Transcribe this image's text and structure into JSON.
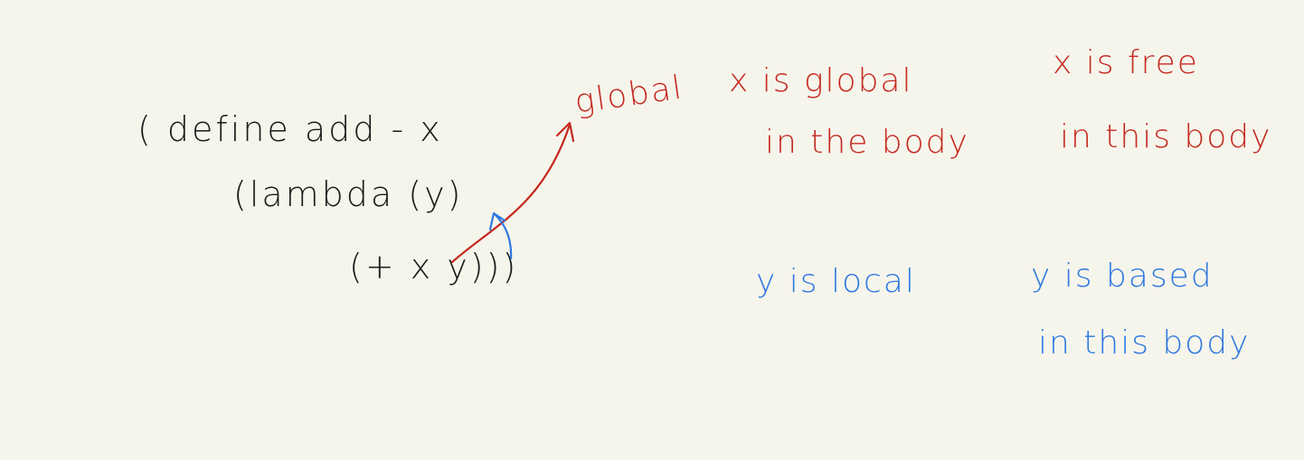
{
  "colors": {
    "background": "#f6f5ec",
    "code_ink": "#1b1b1b",
    "global_ink": "#c4291f",
    "local_ink": "#2f78e0"
  },
  "code": {
    "line1": "( define   add - x",
    "line2": "(lambda  (y)",
    "line3": "(+  x   y)))"
  },
  "annotations": {
    "global_label": "global",
    "x_is_global": "x  is  global",
    "in_the_body": "in  the body",
    "x_is_free": "x  is  free",
    "in_this_body_x": "in  this  body",
    "y_is_local": "y  is  local",
    "y_is_based": "y  is  based",
    "in_this_body_y": "in  this  body"
  }
}
